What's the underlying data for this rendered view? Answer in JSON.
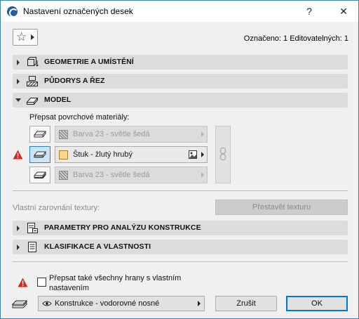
{
  "window": {
    "title": "Nastavení označených desek",
    "help_label": "?",
    "close_label": "✕"
  },
  "header": {
    "favorites_icon": "star-icon",
    "selection_info": "Označeno: 1 Editovatelných: 1"
  },
  "sections": {
    "geometry": "GEOMETRIE A UMÍSTĚNÍ",
    "floorplan": "PŮDORYS A ŘEZ",
    "model": "MODEL",
    "structural": "PARAMETRY PRO ANALÝZU KONSTRUKCE",
    "classification": "KLASIFIKACE A VLASTNOSTI"
  },
  "model": {
    "override_label": "Přepsat povrchové materiály:",
    "surfaces": [
      {
        "name": "top-surface",
        "material": "Barva 23 - světle šedá",
        "enabled": false,
        "selected": false
      },
      {
        "name": "edge-surface",
        "material": "Štuk - žlutý hrubý",
        "enabled": true,
        "selected": true
      },
      {
        "name": "bottom-surface",
        "material": "Barva 23 - světle šedá",
        "enabled": false,
        "selected": false
      }
    ],
    "texture_label": "Vlastní zarovnání textury:",
    "rebuild_texture": "Přestavět texturu"
  },
  "footer": {
    "override_edges_label": "Přepsat také všechny hrany s vlastním nastavením",
    "override_edges_checked": false,
    "layer": "Konstrukce - vodorovné nosné",
    "cancel": "Zrušit",
    "ok": "OK"
  },
  "colors": {
    "accent": "#0078d7",
    "selected_bg": "#cce4f7",
    "material_swatch": "#fcd592",
    "warning": "#d9261c"
  }
}
